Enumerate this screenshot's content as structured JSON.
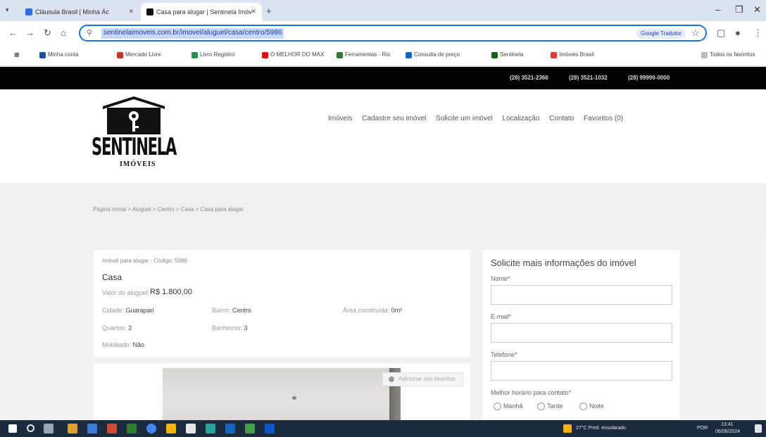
{
  "browser": {
    "tabs": [
      {
        "label": "Cláusula Brasil | Minha Ác",
        "color": "#2f6de1"
      },
      {
        "label": "Casa para alugar | Sentinela Imóv",
        "color": "#111111"
      }
    ],
    "new_tab": "+",
    "url": "sentinelaimoveis.com.br/imovel/aluguel/casa/centro/5986",
    "translate_label": "Google Tradutor",
    "bookmarks": [
      {
        "label": "Minha conta",
        "color": "#1a4fa0"
      },
      {
        "label": "Mercado Livre",
        "color": "#c0392b"
      },
      {
        "label": "Livro Registro",
        "color": "#2e8b57"
      },
      {
        "label": "O MELHOR DO MAX",
        "color": "#d11"
      },
      {
        "label": "Ferramentas - Rio",
        "color": "#2e7d32"
      },
      {
        "label": "Consulta de preço",
        "color": "#1565c0"
      },
      {
        "label": "Sentinela",
        "color": "#1b5e20"
      },
      {
        "label": "Imóveis Brasil",
        "color": "#e53935"
      }
    ],
    "other_bookmarks": "Todos os favoritos"
  },
  "site": {
    "phones": [
      "(28) 3521-2366",
      "(28) 3521-1032",
      "(28) 99999-0000"
    ],
    "logo_title": "SENTINELA",
    "logo_subtitle": "IMÓVEIS",
    "nav": [
      "Imóveis",
      "Cadastre seu imóvel",
      "Solicite um imóvel",
      "Localização",
      "Contato",
      "Favoritos (0)"
    ],
    "breadcrumb": "Página inicial > Aluguel > Centro > Casa > Casa para alugar"
  },
  "property": {
    "subtitle": "Imóvel para alugar - Código: 5986",
    "type": "Casa",
    "price_label": "Valor do aluguel:",
    "price": "R$ 1.800,00",
    "fields": {
      "cidade_label": "Cidade:",
      "cidade": "Guarapari",
      "bairro_label": "Bairro:",
      "bairro": "Centro",
      "area_label": "Área construída:",
      "area": "0m²",
      "quartos_label": "Quartos:",
      "quartos": "3",
      "banheiros_label": "Banheiros:",
      "banheiros": "3",
      "mobiliado_label": "Mobiliado:",
      "mobiliado": "Não"
    },
    "favorite_button": "Adicionar aos favoritos"
  },
  "form": {
    "title": "Solicite mais informações do imóvel",
    "nome_label": "Nome*",
    "email_label": "E-mail*",
    "telefone_label": "Telefone*",
    "contato_label": "Melhor horário para contato*",
    "options": [
      "Manhã",
      "Tarde",
      "Noite"
    ]
  },
  "taskbar": {
    "weather": "27°C Pred. ensolarado",
    "time": "13:41",
    "date": "06/06/2024",
    "lang": "POR"
  }
}
